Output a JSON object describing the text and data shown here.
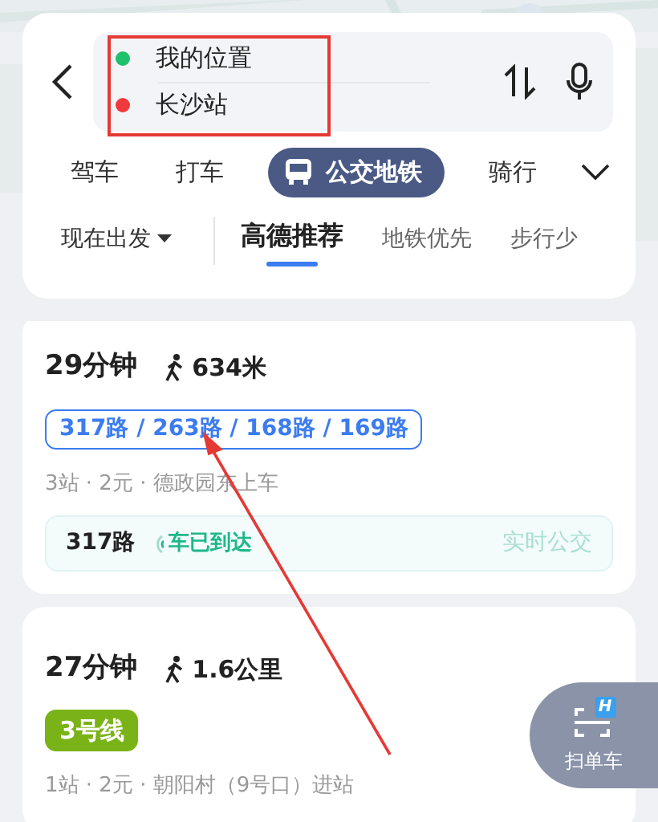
{
  "route_input": {
    "origin": {
      "text": "我的位置",
      "color": "#1fc16b"
    },
    "destination": {
      "text": "长沙站",
      "color": "#f0393b"
    }
  },
  "modes": [
    {
      "label": "驾车",
      "selected": false
    },
    {
      "label": "打车",
      "selected": false
    },
    {
      "label": "公交地铁",
      "selected": true
    },
    {
      "label": "骑行",
      "selected": false
    }
  ],
  "depart": "现在出发",
  "sort_tabs": [
    {
      "label": "高德推荐",
      "selected": true
    },
    {
      "label": "地铁优先",
      "selected": false
    },
    {
      "label": "步行少",
      "selected": false
    }
  ],
  "routes": [
    {
      "duration": "29分钟",
      "walk": "634米",
      "line": {
        "text": "317路 / 263路 / 168路 / 169路",
        "kind": "outline",
        "color": "#3b7cf0"
      },
      "info": "3站 · 2元 · 德政园东上车",
      "realtime": {
        "line": "317路",
        "status": "车已到达",
        "label": "实时公交"
      }
    },
    {
      "duration": "27分钟",
      "walk": "1.6公里",
      "line": {
        "text": "3号线",
        "kind": "filled",
        "color": "#7ab317"
      },
      "info": "1站 · 2元 · 朝阳村（9号口）进站"
    }
  ],
  "scan_button": {
    "label": "扫单车",
    "badge": "H"
  }
}
